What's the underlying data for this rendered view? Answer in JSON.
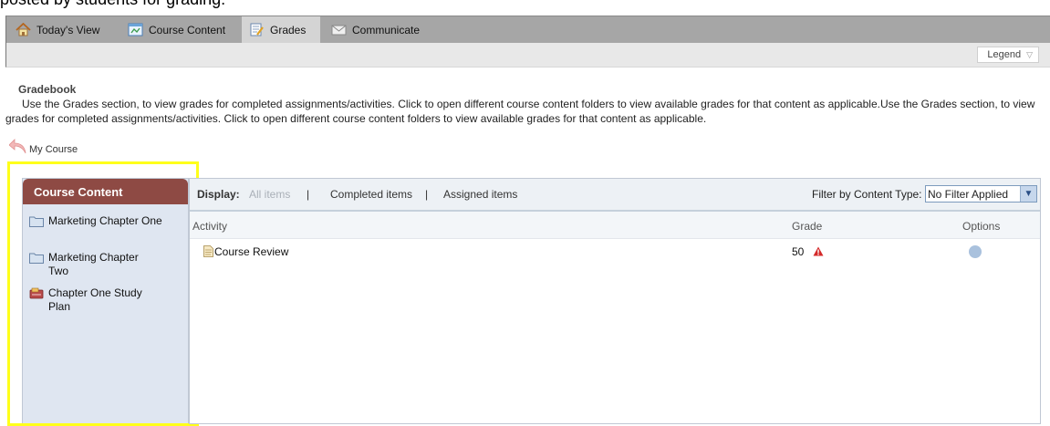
{
  "caption": "posted by students for grading.",
  "nav": {
    "tabs": [
      {
        "label": "Today's View",
        "icon": "home-icon"
      },
      {
        "label": "Course Content",
        "icon": "course-content-icon"
      },
      {
        "label": "Grades",
        "icon": "grades-icon",
        "active": true
      },
      {
        "label": "Communicate",
        "icon": "envelope-icon"
      }
    ]
  },
  "legend_label": "Legend",
  "gradebook": {
    "title": "Gradebook",
    "description": "Use the Grades section, to view grades for completed assignments/activities. Click to open different course content folders to view available grades for that content as applicable.Use the Grades section, to view grades for completed assignments/activities. Click to open different course content folders to view available grades for that content as applicable."
  },
  "breadcrumb": "My Course",
  "sidebar": {
    "header": "Course Content",
    "items": [
      {
        "label": "Marketing Chapter One",
        "icon": "folder-icon"
      },
      {
        "label": "Marketing Chapter Two",
        "icon": "folder-icon"
      },
      {
        "label": "Chapter One Study Plan",
        "icon": "study-plan-icon"
      }
    ]
  },
  "display": {
    "label": "Display:",
    "all": "All items",
    "completed": "Completed items",
    "assigned": "Assigned items",
    "separator": "|"
  },
  "filter": {
    "label": "Filter by Content Type:",
    "value": "No Filter Applied"
  },
  "table": {
    "headers": [
      "Activity",
      "Grade",
      "Options"
    ],
    "rows": [
      {
        "activity": "Course Review",
        "grade": "50"
      }
    ]
  },
  "colors": {
    "nav_bg": "#a6a6a6",
    "sidebar_header": "#8e4a44",
    "sidebar_bg": "#dfe6f1",
    "highlight": "#ffff1a"
  }
}
